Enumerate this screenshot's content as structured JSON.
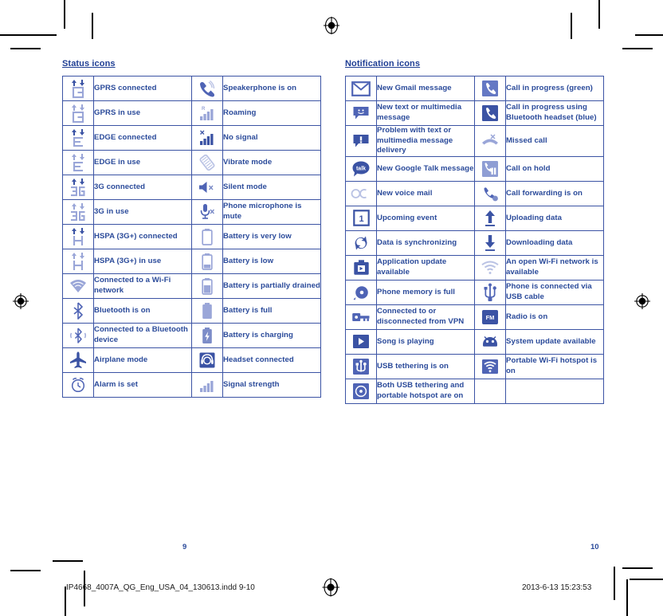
{
  "document": {
    "left_page": {
      "section_title": "Status icons",
      "page_number": "9"
    },
    "right_page": {
      "section_title": "Notification icons",
      "page_number": "10"
    },
    "footer": {
      "file_slug": "IP4668_4007A_QG_Eng_USA_04_130613.indd   9-10",
      "timestamp": "2013-6-13   15:23:53"
    },
    "colors": {
      "text_blue": "#2a4a9a",
      "title_blue": "#1f3e94",
      "border_blue": "#3b53a4",
      "icon_dark": "#3b53a4",
      "icon_light": "#9aa6d8",
      "icon_mid": "#7c8cc8"
    }
  },
  "status_icons": [
    {
      "icon": "gprs-connected-icon",
      "label": "GPRS connected",
      "icon2": "speakerphone-icon",
      "label2": "Speakerphone is on"
    },
    {
      "icon": "gprs-in-use-icon",
      "label": "GPRS in use",
      "icon2": "roaming-icon",
      "label2": "Roaming"
    },
    {
      "icon": "edge-connected-icon",
      "label": "EDGE connected",
      "icon2": "no-signal-icon",
      "label2": "No signal"
    },
    {
      "icon": "edge-in-use-icon",
      "label": "EDGE in use",
      "icon2": "vibrate-mode-icon",
      "label2": "Vibrate mode"
    },
    {
      "icon": "3g-connected-icon",
      "label": "3G connected",
      "icon2": "silent-mode-icon",
      "label2": "Silent mode"
    },
    {
      "icon": "3g-in-use-icon",
      "label": "3G in use",
      "icon2": "mic-mute-icon",
      "label2": "Phone microphone is mute"
    },
    {
      "icon": "hspa-connected-icon",
      "label": "HSPA (3G+) connected",
      "icon2": "battery-very-low-icon",
      "label2": "Battery is very low"
    },
    {
      "icon": "hspa-in-use-icon",
      "label": "HSPA (3G+) in use",
      "icon2": "battery-low-icon",
      "label2": "Battery is low"
    },
    {
      "icon": "wifi-connected-icon",
      "label": "Connected to a Wi-Fi network",
      "icon2": "battery-partial-icon",
      "label2": "Battery is partially drained"
    },
    {
      "icon": "bluetooth-on-icon",
      "label": "Bluetooth is on",
      "icon2": "battery-full-icon",
      "label2": "Battery is full"
    },
    {
      "icon": "bluetooth-connected-icon",
      "label": "Connected to a Bluetooth device",
      "icon2": "battery-charging-icon",
      "label2": "Battery is charging"
    },
    {
      "icon": "airplane-mode-icon",
      "label": "Airplane mode",
      "icon2": "headset-icon",
      "label2": "Headset connected"
    },
    {
      "icon": "alarm-icon",
      "label": "Alarm is set",
      "icon2": "signal-strength-icon",
      "label2": "Signal strength"
    }
  ],
  "notification_icons": [
    {
      "icon": "gmail-icon",
      "label": "New Gmail message",
      "icon2": "call-in-progress-icon",
      "label2": "Call in progress (green)"
    },
    {
      "icon": "sms-icon",
      "label": "New text or multimedia message",
      "icon2": "call-bluetooth-icon",
      "label2": "Call in progress using Bluetooth headset (blue)"
    },
    {
      "icon": "sms-problem-icon",
      "label": "Problem with text or multimedia message delivery",
      "icon2": "missed-call-icon",
      "label2": "Missed call"
    },
    {
      "icon": "google-talk-icon",
      "label": "New Google Talk message",
      "icon2": "call-on-hold-icon",
      "label2": "Call on hold"
    },
    {
      "icon": "voicemail-icon",
      "label": "New voice mail",
      "icon2": "call-forwarding-icon",
      "label2": "Call forwarding is on"
    },
    {
      "icon": "calendar-event-icon",
      "label": "Upcoming event",
      "icon2": "upload-icon",
      "label2": "Uploading data"
    },
    {
      "icon": "sync-icon",
      "label": "Data is synchronizing",
      "icon2": "download-icon",
      "label2": "Downloading data"
    },
    {
      "icon": "app-update-icon",
      "label": "Application update available",
      "icon2": "open-wifi-icon",
      "label2": "An open Wi-Fi network is available"
    },
    {
      "icon": "memory-full-icon",
      "label": "Phone memory is full",
      "icon2": "usb-cable-icon",
      "label2": "Phone is connected via USB cable"
    },
    {
      "icon": "vpn-icon",
      "label": "Connected to or disconnected from VPN",
      "icon2": "fm-radio-icon",
      "label2": "Radio is on"
    },
    {
      "icon": "play-icon",
      "label": "Song is playing",
      "icon2": "system-update-icon",
      "label2": "System update available"
    },
    {
      "icon": "usb-tethering-icon",
      "label": "USB tethering is on",
      "icon2": "wifi-hotspot-icon",
      "label2": "Portable Wi-Fi hotspot is on"
    },
    {
      "icon": "both-tethering-icon",
      "label": "Both USB tethering and portable hotspot are on",
      "icon2": "",
      "label2": ""
    }
  ]
}
